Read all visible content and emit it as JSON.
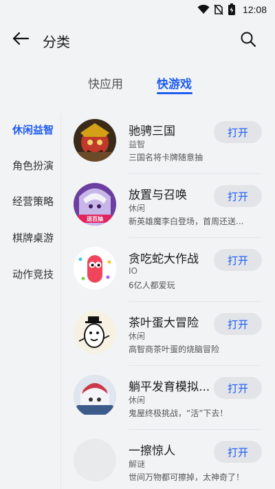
{
  "status_bar": {
    "time": "12:08"
  },
  "header": {
    "title": "分类"
  },
  "tabs": [
    {
      "label": "快应用",
      "active": false
    },
    {
      "label": "快游戏",
      "active": true
    }
  ],
  "sidebar": {
    "items": [
      {
        "label": "休闲益智",
        "active": true
      },
      {
        "label": "角色扮演",
        "active": false
      },
      {
        "label": "经营策略",
        "active": false
      },
      {
        "label": "棋牌桌游",
        "active": false
      },
      {
        "label": "动作竞技",
        "active": false
      }
    ]
  },
  "games": [
    {
      "title": "驰骋三国",
      "tag": "益智",
      "desc": "三国名将卡牌随意抽",
      "button": "打开"
    },
    {
      "title": "放置与召唤",
      "tag": "休闲",
      "desc": "新英雄魔李白登场，首周还送...",
      "button": "打开",
      "badge": "送百抽"
    },
    {
      "title": "贪吃蛇大作战",
      "tag": "IO",
      "desc": "6亿人都爱玩",
      "button": "打开"
    },
    {
      "title": "茶叶蛋大冒险",
      "tag": "休闲",
      "desc": "高智商茶叶蛋的烧脑冒险",
      "button": "打开"
    },
    {
      "title": "躺平发育模拟...",
      "tag": "休闲",
      "desc": "鬼屋终极挑战，“活”下去！",
      "button": "打开"
    },
    {
      "title": "一擦惊人",
      "tag": "解谜",
      "desc": "世间万物都可擦掉，太神奇了！",
      "button": "打开"
    }
  ],
  "colors": {
    "accent": "#1f5cf0",
    "background": "#f1f3f5",
    "button_bg": "#e2e4e8"
  }
}
